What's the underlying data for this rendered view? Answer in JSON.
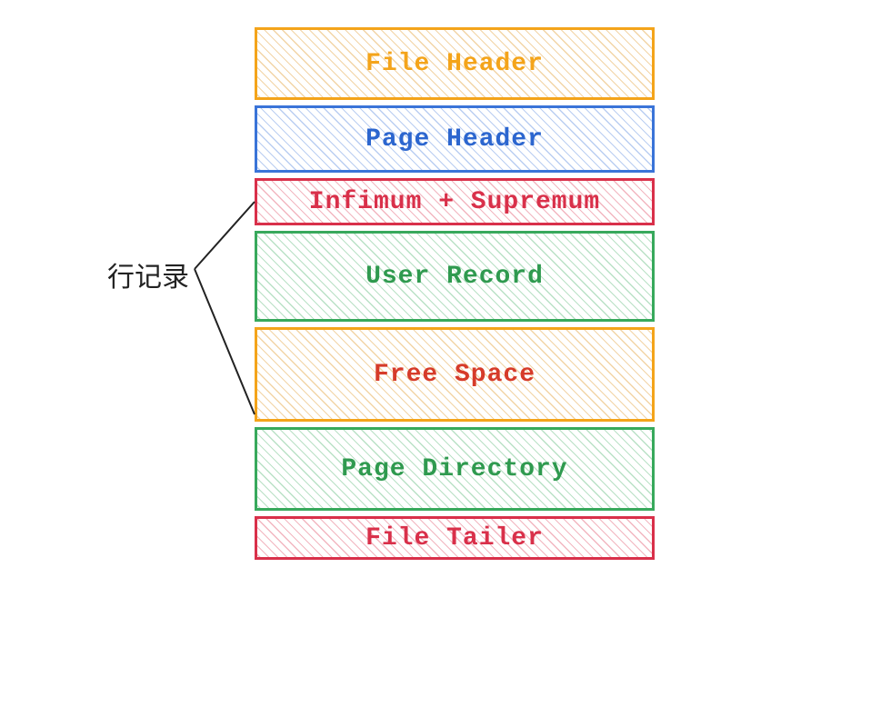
{
  "annotation": "行记录",
  "blocks": [
    {
      "label": "File Header"
    },
    {
      "label": "Page Header"
    },
    {
      "label": "Infimum + Supremum"
    },
    {
      "label": "User Record"
    },
    {
      "label": "Free Space"
    },
    {
      "label": "Page Directory"
    },
    {
      "label": "File Tailer"
    }
  ]
}
